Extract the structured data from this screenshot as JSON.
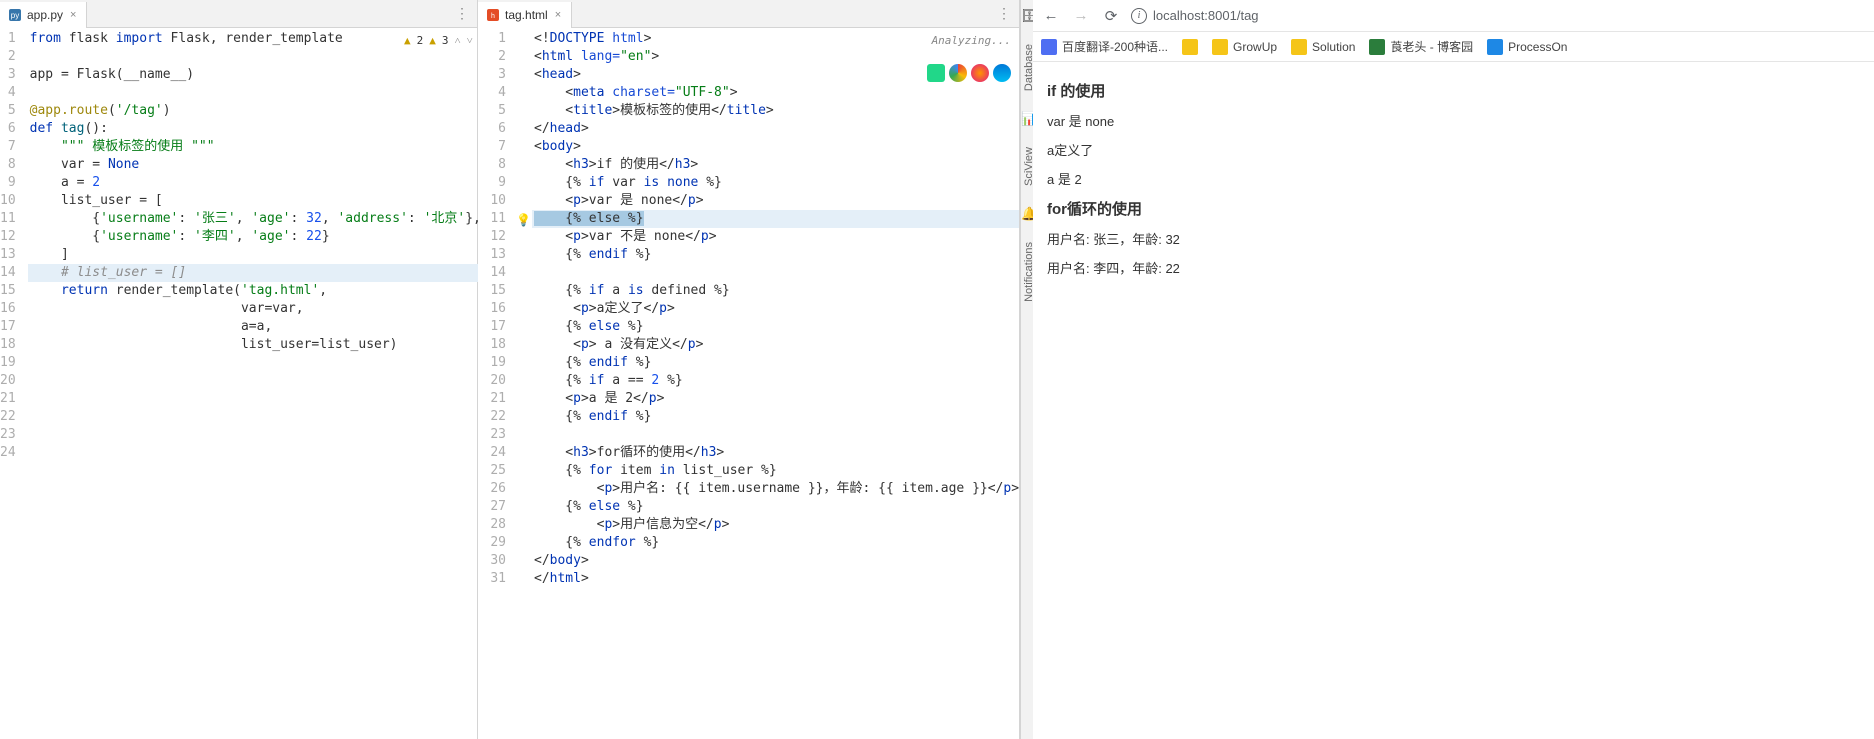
{
  "left_editor": {
    "tab_filename": "app.py",
    "warnings": {
      "w1": "2",
      "w2": "3"
    },
    "lines": {
      "1": [
        [
          "kw",
          "from"
        ],
        [
          "",
          " flask "
        ],
        [
          "kw",
          "import"
        ],
        [
          "",
          " Flask"
        ],
        [
          "",
          ","
        ],
        [
          "",
          " render_template"
        ]
      ],
      "2": [
        [
          "",
          ""
        ]
      ],
      "3": [
        [
          "",
          "app = Flask(__name__)"
        ]
      ],
      "4": [
        [
          "",
          ""
        ]
      ],
      "5": [
        [
          "dec",
          "@app.route"
        ],
        [
          "",
          "("
        ],
        [
          "str",
          "'/tag'"
        ],
        [
          "",
          ")"
        ]
      ],
      "6": [
        [
          "kw",
          "def "
        ],
        [
          "fn",
          "tag"
        ],
        [
          "",
          "():"
        ]
      ],
      "7": [
        [
          "",
          "    "
        ],
        [
          "str",
          "\"\"\" 模板标签的使用 \"\"\""
        ]
      ],
      "8": [
        [
          "",
          "    var = "
        ],
        [
          "kw",
          "None"
        ]
      ],
      "9": [
        [
          "",
          "    a = "
        ],
        [
          "num",
          "2"
        ]
      ],
      "10": [
        [
          "",
          "    list_user = ["
        ]
      ],
      "11": [
        [
          "",
          "        {"
        ],
        [
          "str",
          "'username'"
        ],
        [
          "",
          ": "
        ],
        [
          "str",
          "'张三'"
        ],
        [
          "",
          ", "
        ],
        [
          "str",
          "'age'"
        ],
        [
          "",
          ": "
        ],
        [
          "num",
          "32"
        ],
        [
          "",
          ", "
        ],
        [
          "str",
          "'address'"
        ],
        [
          "",
          ": "
        ],
        [
          "str",
          "'北京'"
        ],
        [
          "",
          "},"
        ]
      ],
      "12": [
        [
          "",
          "        {"
        ],
        [
          "str",
          "'username'"
        ],
        [
          "",
          ": "
        ],
        [
          "str",
          "'李四'"
        ],
        [
          "",
          ", "
        ],
        [
          "str",
          "'age'"
        ],
        [
          "",
          ": "
        ],
        [
          "num",
          "22"
        ],
        [
          "",
          "}"
        ]
      ],
      "13": [
        [
          "",
          "    ]"
        ]
      ],
      "14": [
        [
          "",
          "    "
        ],
        [
          "comment",
          "# list_user = []"
        ]
      ],
      "15": [
        [
          "",
          "    "
        ],
        [
          "kw",
          "return "
        ],
        [
          "",
          "render_template("
        ],
        [
          "str",
          "'tag.html'"
        ],
        [
          "",
          ","
        ]
      ],
      "16": [
        [
          "",
          "                           var=var,"
        ]
      ],
      "17": [
        [
          "",
          "                           a=a,"
        ]
      ],
      "18": [
        [
          "",
          "                           list_user=list_user)"
        ]
      ]
    },
    "max_line": 24
  },
  "right_editor": {
    "tab_filename": "tag.html",
    "status": "Analyzing...",
    "lines": {
      "1": [
        [
          "",
          "<!"
        ],
        [
          "tag",
          "DOCTYPE "
        ],
        [
          "attr",
          "html"
        ],
        [
          "",
          ">"
        ]
      ],
      "2": [
        [
          "",
          "<"
        ],
        [
          "tag",
          "html "
        ],
        [
          "attr",
          "lang="
        ],
        [
          "attrval",
          "\"en\""
        ],
        [
          "",
          ">"
        ]
      ],
      "3": [
        [
          "",
          "<"
        ],
        [
          "tag",
          "head"
        ],
        [
          "",
          ">"
        ]
      ],
      "4": [
        [
          "",
          "    <"
        ],
        [
          "tag",
          "meta "
        ],
        [
          "attr",
          "charset="
        ],
        [
          "attrval",
          "\"UTF-8\""
        ],
        [
          "",
          ">"
        ]
      ],
      "5": [
        [
          "",
          "    <"
        ],
        [
          "tag",
          "title"
        ],
        [
          "",
          ">模板标签的使用</"
        ],
        [
          "tag",
          "title"
        ],
        [
          "",
          ">"
        ]
      ],
      "6": [
        [
          "",
          "</"
        ],
        [
          "tag",
          "head"
        ],
        [
          "",
          ">"
        ]
      ],
      "7": [
        [
          "",
          "<"
        ],
        [
          "tag",
          "body"
        ],
        [
          "",
          ">"
        ]
      ],
      "8": [
        [
          "",
          "    <"
        ],
        [
          "tag",
          "h3"
        ],
        [
          "",
          ">if 的使用</"
        ],
        [
          "tag",
          "h3"
        ],
        [
          "",
          ">"
        ]
      ],
      "9": [
        [
          "",
          "    {% "
        ],
        [
          "tmpl",
          "if "
        ],
        [
          "",
          "var "
        ],
        [
          "tmpl",
          "is "
        ],
        [
          "tmpl",
          "none"
        ],
        [
          "",
          " %}"
        ]
      ],
      "10": [
        [
          "",
          "    <"
        ],
        [
          "tag",
          "p"
        ],
        [
          "",
          ">var 是 none</"
        ],
        [
          "tag",
          "p"
        ],
        [
          "",
          ">"
        ]
      ],
      "11": [
        [
          "sel",
          "    {% else %}"
        ]
      ],
      "12": [
        [
          "",
          "    <"
        ],
        [
          "tag",
          "p"
        ],
        [
          "",
          ">var 不是 none</"
        ],
        [
          "tag",
          "p"
        ],
        [
          "",
          ">"
        ]
      ],
      "13": [
        [
          "",
          "    {% "
        ],
        [
          "tmpl",
          "endif"
        ],
        [
          "",
          " %}"
        ]
      ],
      "14": [
        [
          "",
          ""
        ]
      ],
      "15": [
        [
          "",
          "    {% "
        ],
        [
          "tmpl",
          "if "
        ],
        [
          "",
          "a "
        ],
        [
          "tmpl",
          "is "
        ],
        [
          "",
          "defined %}"
        ]
      ],
      "16": [
        [
          "",
          "     <"
        ],
        [
          "tag",
          "p"
        ],
        [
          "",
          ">a定义了</"
        ],
        [
          "tag",
          "p"
        ],
        [
          "",
          ">"
        ]
      ],
      "17": [
        [
          "",
          "    {% "
        ],
        [
          "tmpl",
          "else"
        ],
        [
          "",
          " %}"
        ]
      ],
      "18": [
        [
          "",
          "     <"
        ],
        [
          "tag",
          "p"
        ],
        [
          "",
          "> a 没有定义</"
        ],
        [
          "tag",
          "p"
        ],
        [
          "",
          ">"
        ]
      ],
      "19": [
        [
          "",
          "    {% "
        ],
        [
          "tmpl",
          "endif"
        ],
        [
          "",
          " %}"
        ]
      ],
      "20": [
        [
          "",
          "    {% "
        ],
        [
          "tmpl",
          "if "
        ],
        [
          "",
          "a == "
        ],
        [
          "num",
          "2"
        ],
        [
          "",
          " %}"
        ]
      ],
      "21": [
        [
          "",
          "    <"
        ],
        [
          "tag",
          "p"
        ],
        [
          "",
          ">a 是 2</"
        ],
        [
          "tag",
          "p"
        ],
        [
          "",
          ">"
        ]
      ],
      "22": [
        [
          "",
          "    {% "
        ],
        [
          "tmpl",
          "endif"
        ],
        [
          "",
          " %}"
        ]
      ],
      "23": [
        [
          "",
          ""
        ]
      ],
      "24": [
        [
          "",
          "    <"
        ],
        [
          "tag",
          "h3"
        ],
        [
          "",
          ">for循环的使用</"
        ],
        [
          "tag",
          "h3"
        ],
        [
          "",
          ">"
        ]
      ],
      "25": [
        [
          "",
          "    {% "
        ],
        [
          "tmpl",
          "for "
        ],
        [
          "",
          "item "
        ],
        [
          "tmpl",
          "in "
        ],
        [
          "",
          "list_user %}"
        ]
      ],
      "26": [
        [
          "",
          "        <"
        ],
        [
          "tag",
          "p"
        ],
        [
          "",
          ">用户名: {{ item"
        ],
        [
          "",
          ".username }}，年龄: {{ item"
        ],
        [
          "",
          ".age }}</"
        ],
        [
          "tag",
          "p"
        ],
        [
          "",
          ">"
        ]
      ],
      "27": [
        [
          "",
          "    {% "
        ],
        [
          "tmpl",
          "else"
        ],
        [
          "",
          " %}"
        ]
      ],
      "28": [
        [
          "",
          "        <"
        ],
        [
          "tag",
          "p"
        ],
        [
          "",
          ">用户信息为空</"
        ],
        [
          "tag",
          "p"
        ],
        [
          "",
          ">"
        ]
      ],
      "29": [
        [
          "",
          "    {% "
        ],
        [
          "tmpl",
          "endfor"
        ],
        [
          "",
          " %}"
        ]
      ],
      "30": [
        [
          "",
          "</"
        ],
        [
          "tag",
          "body"
        ],
        [
          "",
          ">"
        ]
      ],
      "31": [
        [
          "",
          "</"
        ],
        [
          "tag",
          "html"
        ],
        [
          "",
          ">"
        ]
      ]
    },
    "max_line": 31
  },
  "sidebar": {
    "labels": [
      "Database",
      "SciView",
      "Notifications"
    ]
  },
  "browser": {
    "url": "localhost:8001/tag",
    "bookmarks": [
      {
        "label": "百度翻译-200种语...",
        "color": "#4e6ef2"
      },
      {
        "label": "",
        "color": "#f5c518"
      },
      {
        "label": "GrowUp",
        "color": "#f5c518"
      },
      {
        "label": "Solution",
        "color": "#f5c518"
      },
      {
        "label": "莨老头 - 博客园",
        "color": "#2b7d3c"
      },
      {
        "label": "ProcessOn",
        "color": "#1e88e5"
      }
    ],
    "page": {
      "h1": "if 的使用",
      "p1": "var 是 none",
      "p2": "a定义了",
      "p3": "a 是 2",
      "h2": "for循环的使用",
      "p4": "用户名: 张三，年龄: 32",
      "p5": "用户名: 李四，年龄: 22"
    }
  }
}
